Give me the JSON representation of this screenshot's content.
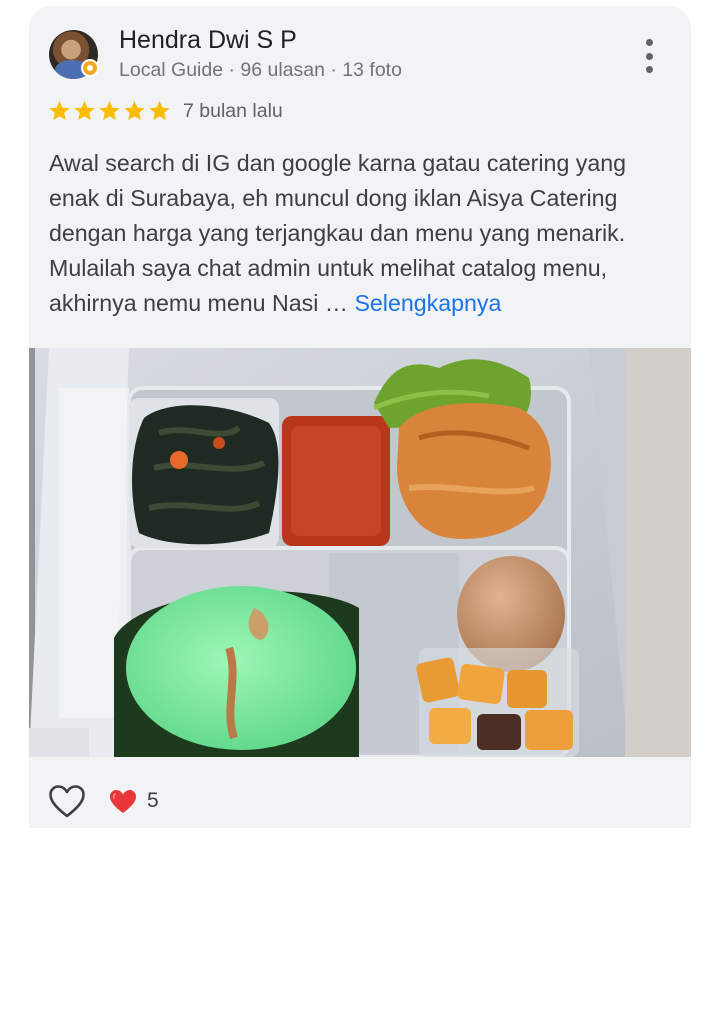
{
  "review": {
    "author": {
      "name": "Hendra Dwi S P",
      "meta": "Local Guide · 96 ulasan · 13 foto",
      "avatar_icon": "user-avatar-photo",
      "badge_icon": "local-guide-badge-icon"
    },
    "menu_icon": "more-vert-icon",
    "rating": 5,
    "max_rating": 5,
    "star_color": "#fbbc04",
    "time": "7 bulan lalu",
    "text": "Awal search di IG dan google karna gatau catering yang enak di Surabaya, eh muncul dong iklan Aisya Catering dengan harga yang terjangkau dan menu yang menarik. Mulailah saya chat admin untuk melihat catalog menu, akhirnya nemu menu Nasi … ",
    "read_more": "Selengkapnya",
    "link_color": "#1a73e8",
    "photo": {
      "subject": "food-photo-catering-box"
    },
    "actions": {
      "like_icon": "heart-outline-icon",
      "reaction_icon": "red-heart-icon",
      "reaction_count": "5"
    }
  }
}
